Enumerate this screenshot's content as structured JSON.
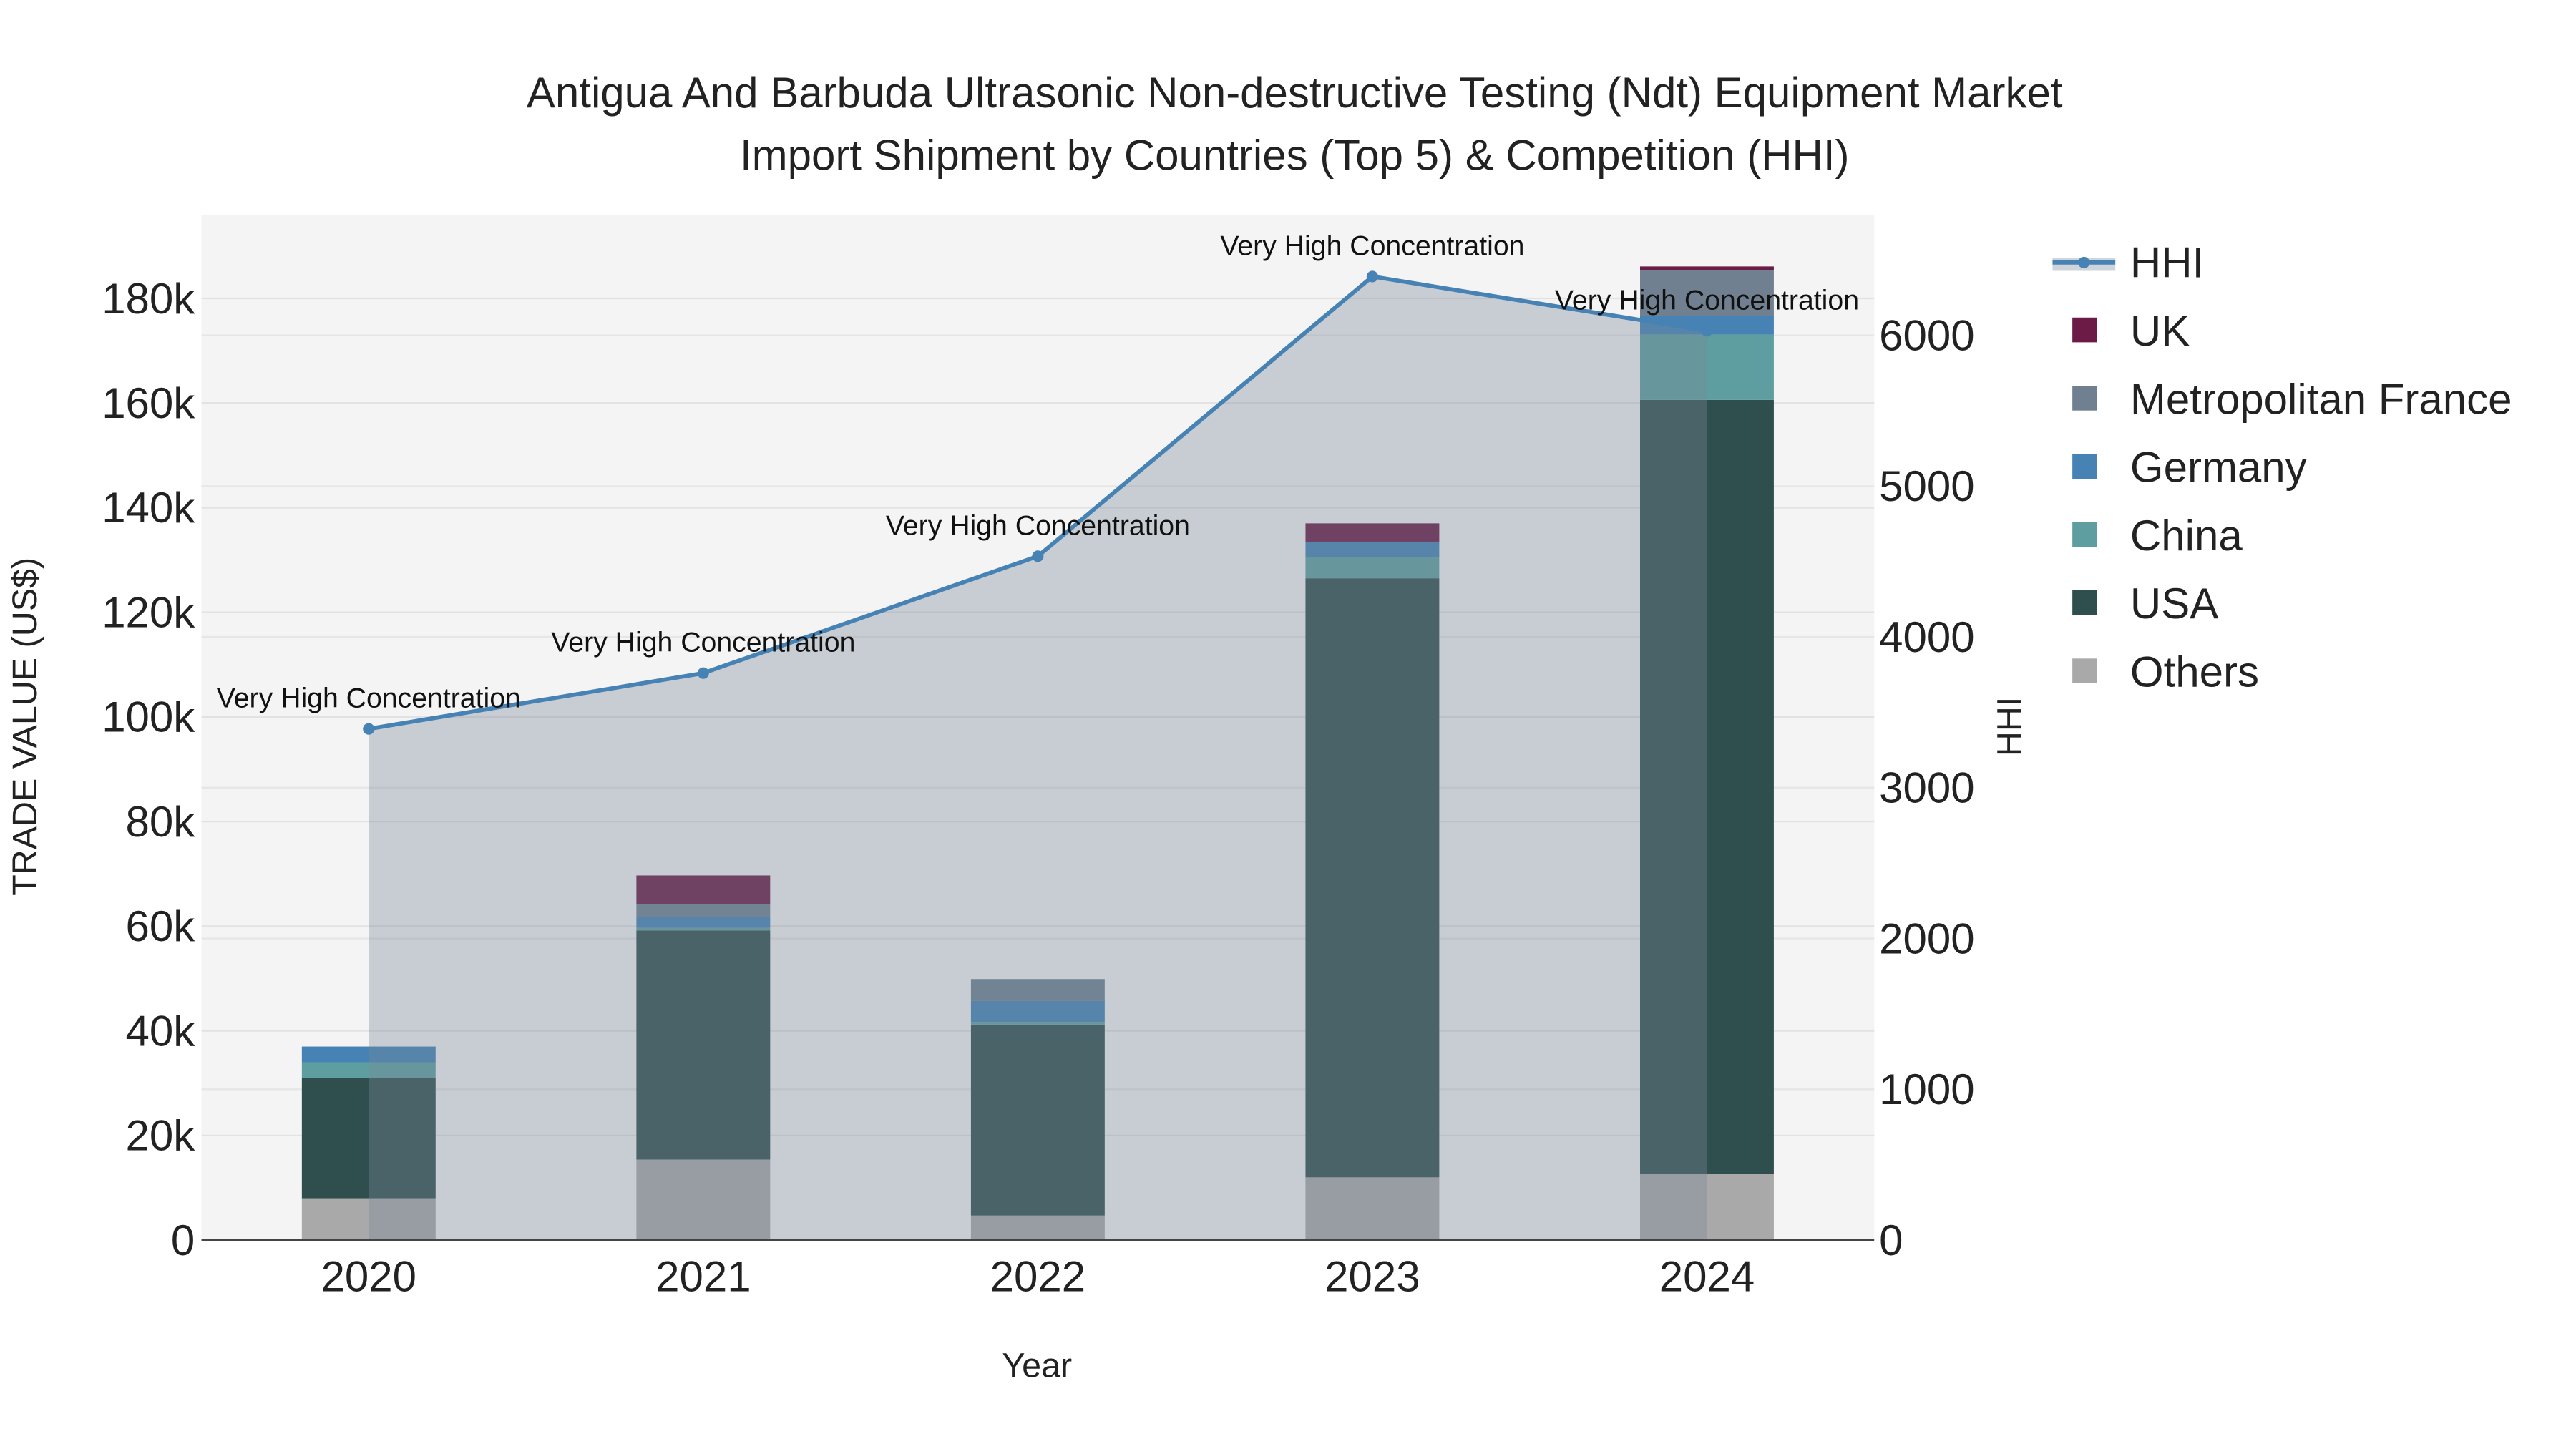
{
  "chart_data": {
    "type": "bar",
    "title_lines": [
      "Antigua And Barbuda Ultrasonic Non-destructive Testing (Ndt) Equipment Market",
      "Import Shipment by Countries (Top 5) & Competition (HHI)"
    ],
    "xlabel": "Year",
    "ylabel": "TRADE VALUE (US$)",
    "y2label": "HHI",
    "categories": [
      "2020",
      "2021",
      "2022",
      "2023",
      "2024"
    ],
    "ylim": [
      0,
      196000
    ],
    "y_ticks": [
      0,
      20000,
      40000,
      60000,
      80000,
      100000,
      120000,
      140000,
      160000,
      180000
    ],
    "y_tick_labels": [
      "0",
      "20k",
      "40k",
      "60k",
      "80k",
      "100k",
      "120k",
      "140k",
      "160k",
      "180k"
    ],
    "y2lim": [
      0,
      6800
    ],
    "y2_ticks": [
      0,
      1000,
      2000,
      3000,
      4000,
      5000,
      6000
    ],
    "y2_tick_labels": [
      "0",
      "1000",
      "2000",
      "3000",
      "4000",
      "5000",
      "6000"
    ],
    "stacked": true,
    "series": [
      {
        "name": "Others",
        "color": "#A9A9A9",
        "values": [
          8000,
          15400,
          4700,
          12000,
          12600
        ]
      },
      {
        "name": "USA",
        "color": "#2F4F4F",
        "values": [
          23000,
          43800,
          36500,
          114500,
          148000
        ]
      },
      {
        "name": "China",
        "color": "#5F9EA0",
        "values": [
          3000,
          500,
          500,
          4000,
          12500
        ]
      },
      {
        "name": "Germany",
        "color": "#4682B4",
        "values": [
          3000,
          2000,
          4000,
          3000,
          3500
        ]
      },
      {
        "name": "Metropolitan France",
        "color": "#708090",
        "values": [
          0,
          2500,
          4200,
          0,
          8800
        ]
      },
      {
        "name": "UK",
        "color": "#6B1B45",
        "values": [
          0,
          5500,
          0,
          3500,
          700
        ]
      }
    ],
    "hhi": {
      "name": "HHI",
      "color": "#4682B4",
      "values": [
        3390,
        3760,
        4535,
        6390,
        6030
      ],
      "annotations": [
        "Very High Concentration",
        "Very High Concentration",
        "Very High Concentration",
        "Very High Concentration",
        "Very High Concentration"
      ]
    },
    "legend": {
      "placement": "right",
      "entries": [
        "HHI",
        "UK",
        "Metropolitan France",
        "Germany",
        "China",
        "USA",
        "Others"
      ]
    },
    "grid": true
  }
}
